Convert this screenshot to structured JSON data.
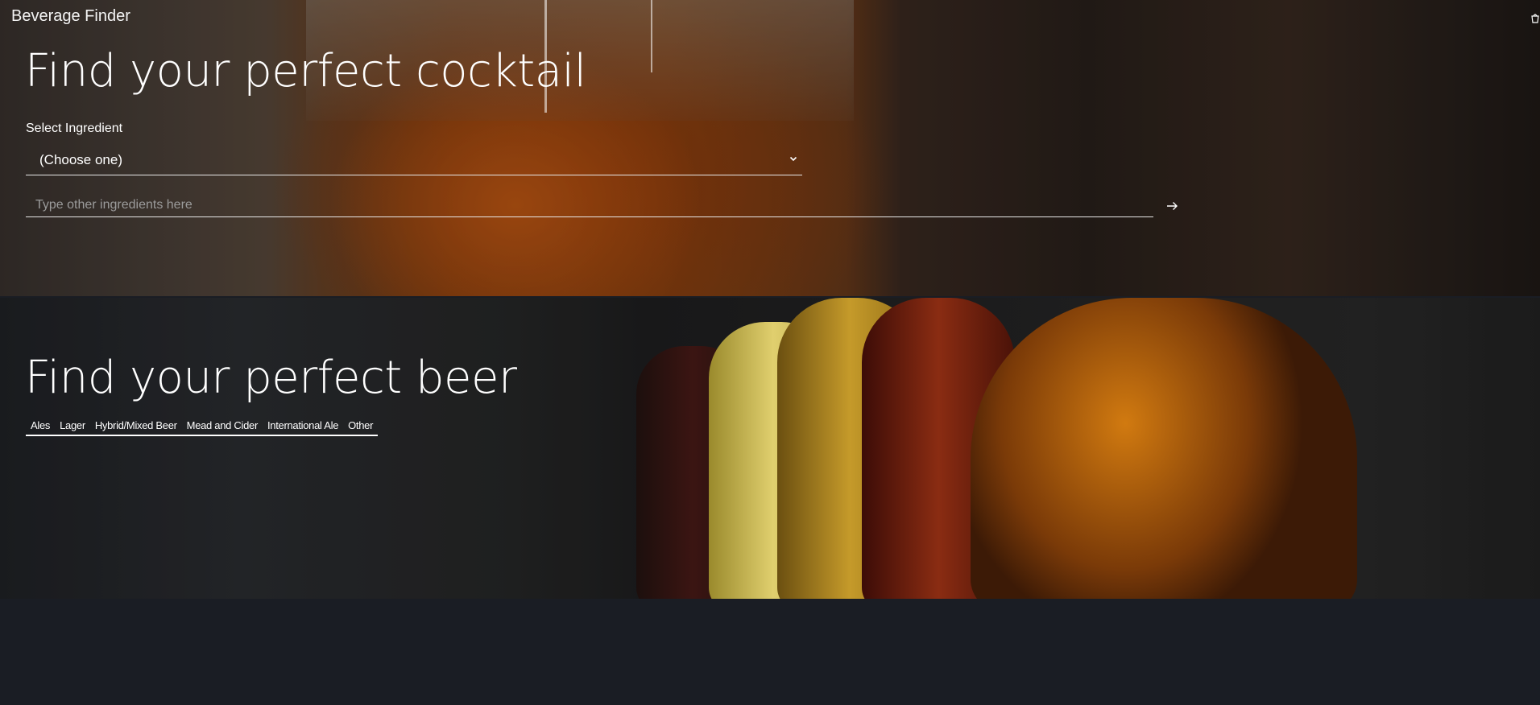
{
  "header": {
    "app_title": "Beverage Finder",
    "cart_icon": "cart-icon"
  },
  "cocktail": {
    "heading": "Find your perfect cocktail",
    "ingredient_label": "Select Ingredient",
    "ingredient_selected": "(Choose one)",
    "other_placeholder": "Type other ingredients here",
    "submit_icon": "arrow-right-icon"
  },
  "beer": {
    "heading": "Find your perfect beer",
    "tabs": [
      {
        "label": "Ales"
      },
      {
        "label": "Lager"
      },
      {
        "label": "Hybrid/Mixed Beer"
      },
      {
        "label": "Mead and Cider"
      },
      {
        "label": "International Ale"
      },
      {
        "label": "Other"
      }
    ]
  },
  "colors": {
    "page_background": "#1a1d24",
    "text": "#ffffff",
    "placeholder": "#9b9b9b"
  }
}
